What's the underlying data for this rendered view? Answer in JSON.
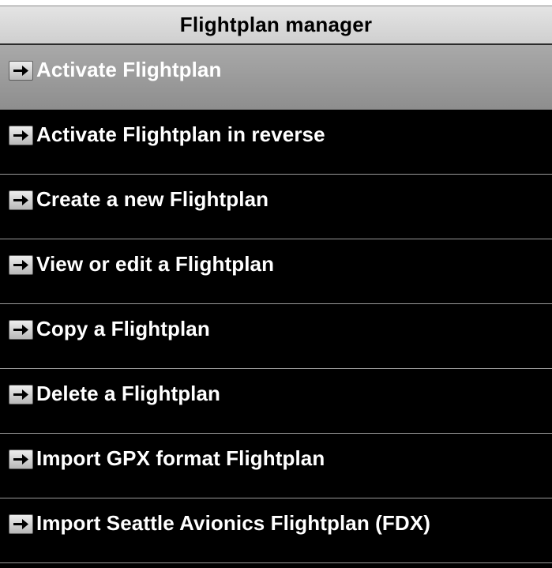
{
  "header": {
    "title": "Flightplan manager"
  },
  "menu": {
    "items": [
      {
        "label": "Activate Flightplan",
        "icon": "arrow-right-icon",
        "selected": true
      },
      {
        "label": "Activate Flightplan in reverse",
        "icon": "arrow-right-icon",
        "selected": false
      },
      {
        "label": "Create a new Flightplan",
        "icon": "arrow-right-icon",
        "selected": false
      },
      {
        "label": "View or edit a Flightplan",
        "icon": "arrow-right-icon",
        "selected": false
      },
      {
        "label": "Copy a Flightplan",
        "icon": "arrow-right-icon",
        "selected": false
      },
      {
        "label": "Delete a Flightplan",
        "icon": "arrow-right-icon",
        "selected": false
      },
      {
        "label": "Import GPX format Flightplan",
        "icon": "arrow-right-icon",
        "selected": false
      },
      {
        "label": "Import Seattle Avionics Flightplan (FDX)",
        "icon": "arrow-right-icon",
        "selected": false
      }
    ]
  },
  "colors": {
    "background": "#000000",
    "header_bg": "#d8d8d8",
    "selected_bg": "#9c9c9c",
    "text_light": "#ffffff",
    "text_dark": "#000000"
  }
}
